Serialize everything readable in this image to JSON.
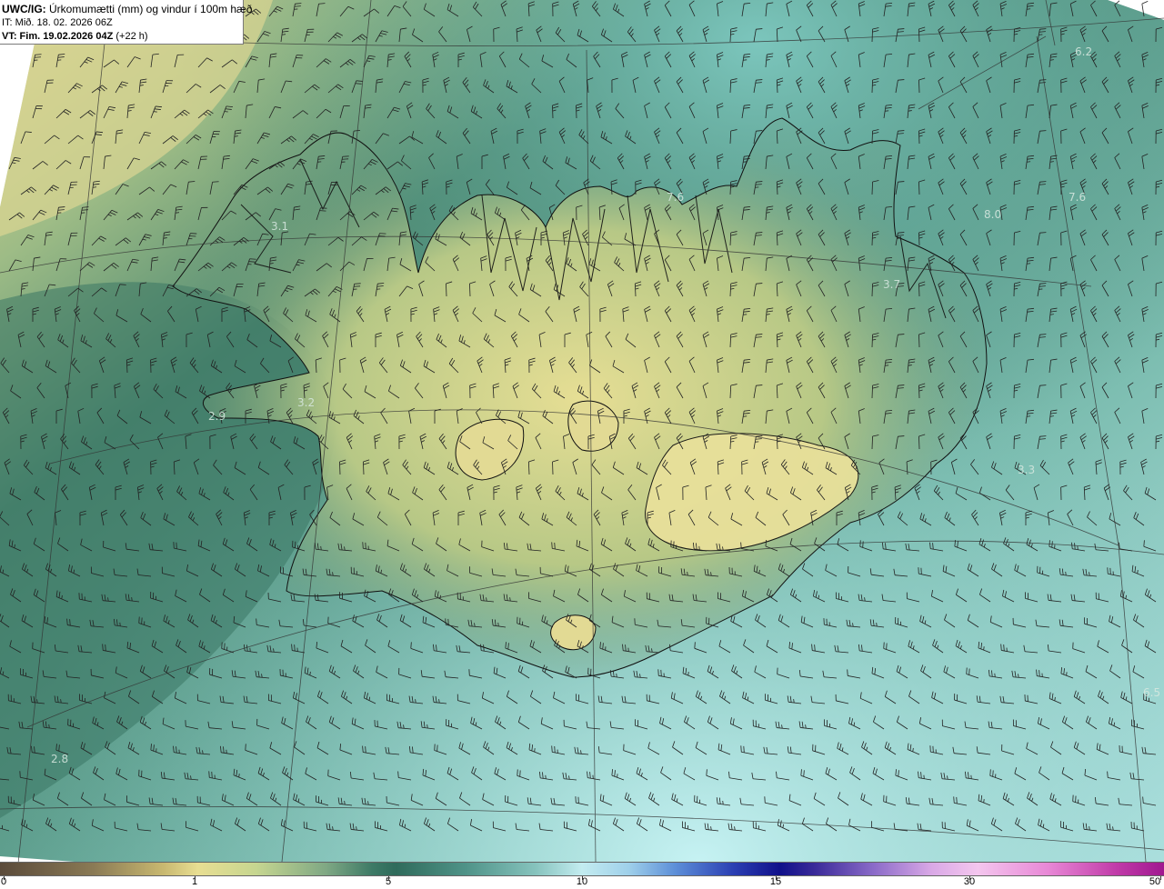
{
  "header": {
    "product": "UWC/IG:",
    "title": "Úrkomumætti (mm) og vindur í 100m hæð",
    "init_time": "IT: Mið. 18. 02. 2026 06Z",
    "valid_prefix": "VT: Fim. 19.02.2026 04Z",
    "valid_suffix": "(+22 h)"
  },
  "map_labels": [
    {
      "id": "ne-62",
      "text": "6.2"
    },
    {
      "id": "north-76",
      "text": "7.6"
    },
    {
      "id": "ne-76",
      "text": "7.6"
    },
    {
      "id": "ne-80",
      "text": "8.0"
    },
    {
      "id": "westfjords-31",
      "text": "3.1"
    },
    {
      "id": "east-37",
      "text": "3.7"
    },
    {
      "id": "snaefells-32",
      "text": "3.2"
    },
    {
      "id": "snaefells-29",
      "text": "2.9"
    },
    {
      "id": "east-33",
      "text": "3.3"
    },
    {
      "id": "se-65",
      "text": "6.5"
    },
    {
      "id": "sw-28",
      "text": "2.8"
    }
  ],
  "legend": {
    "ticks": [
      "0",
      "1",
      "5",
      "10",
      "15",
      "30",
      "50"
    ],
    "colors": {
      "low": "#5a4a3a",
      "one": "#e8de92",
      "five": "#2f6b5b",
      "ten": "#c3ecf0",
      "fifteen": "#10108a",
      "thirty": "#f4c6ee",
      "fifty": "#a01890"
    }
  },
  "map_colors": {
    "dry": "#e6df96",
    "moderate": "#3f7e6b",
    "wet": "#bfeef0",
    "coastline": "#111111",
    "barbs": "#222222"
  }
}
